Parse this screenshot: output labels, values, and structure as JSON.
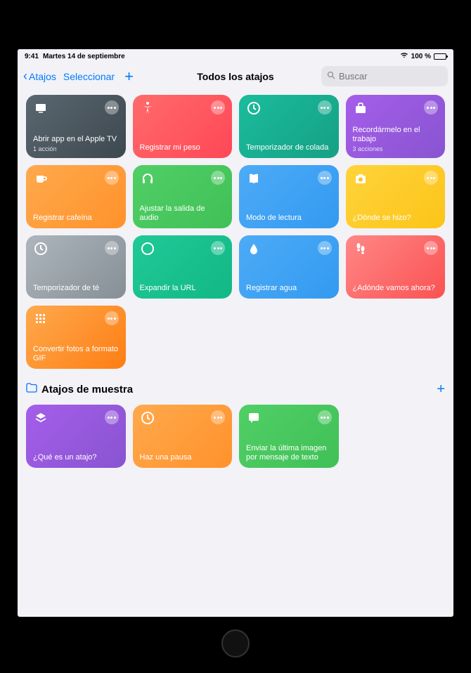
{
  "status": {
    "time": "9:41",
    "date": "Martes 14 de septiembre",
    "battery": "100 %"
  },
  "nav": {
    "back": "Atajos",
    "select": "Seleccionar",
    "title": "Todos los atajos",
    "search_placeholder": "Buscar"
  },
  "main_grid": [
    {
      "id": "apple-tv",
      "label": "Abrir app en el Apple TV",
      "sub": "1 acción",
      "icon": "tv",
      "gradient": "g-darkgray"
    },
    {
      "id": "peso",
      "label": "Registrar mi peso",
      "sub": "",
      "icon": "accessibility",
      "gradient": "g-red"
    },
    {
      "id": "colada",
      "label": "Temporizador de colada",
      "sub": "",
      "icon": "clock",
      "gradient": "g-teal"
    },
    {
      "id": "trabajo",
      "label": "Recordármelo en el trabajo",
      "sub": "3 acciones",
      "icon": "briefcase",
      "gradient": "g-purple"
    },
    {
      "id": "cafeina",
      "label": "Registrar cafeína",
      "sub": "",
      "icon": "cup",
      "gradient": "g-orange"
    },
    {
      "id": "audio",
      "label": "Ajustar la salida de audio",
      "sub": "",
      "icon": "headphones",
      "gradient": "g-green"
    },
    {
      "id": "lectura",
      "label": "Modo de lectura",
      "sub": "",
      "icon": "book",
      "gradient": "g-blue"
    },
    {
      "id": "donde",
      "label": "¿Dónde se hizo?",
      "sub": "",
      "icon": "camera",
      "gradient": "g-yellow"
    },
    {
      "id": "te",
      "label": "Temporizador de té",
      "sub": "",
      "icon": "clock",
      "gradient": "g-gray"
    },
    {
      "id": "url",
      "label": "Expandir la URL",
      "sub": "",
      "icon": "safari",
      "gradient": "g-teal2"
    },
    {
      "id": "agua",
      "label": "Registrar agua",
      "sub": "",
      "icon": "drop",
      "gradient": "g-blue"
    },
    {
      "id": "adonde",
      "label": "¿Adónde vamos ahora?",
      "sub": "",
      "icon": "footsteps",
      "gradient": "g-coral"
    },
    {
      "id": "gif",
      "label": "Convertir fotos a formato GIF",
      "sub": "",
      "icon": "grid",
      "gradient": "g-lightorange"
    }
  ],
  "section": {
    "title": "Atajos de muestra"
  },
  "sample_grid": [
    {
      "id": "que-es",
      "label": "¿Qué es un atajo?",
      "sub": "",
      "icon": "layers",
      "gradient": "g-purple"
    },
    {
      "id": "pausa",
      "label": "Haz una pausa",
      "sub": "",
      "icon": "clock",
      "gradient": "g-orange"
    },
    {
      "id": "imagen",
      "label": "Enviar la última imagen por mensaje de texto",
      "sub": "",
      "icon": "chat",
      "gradient": "g-green"
    }
  ]
}
